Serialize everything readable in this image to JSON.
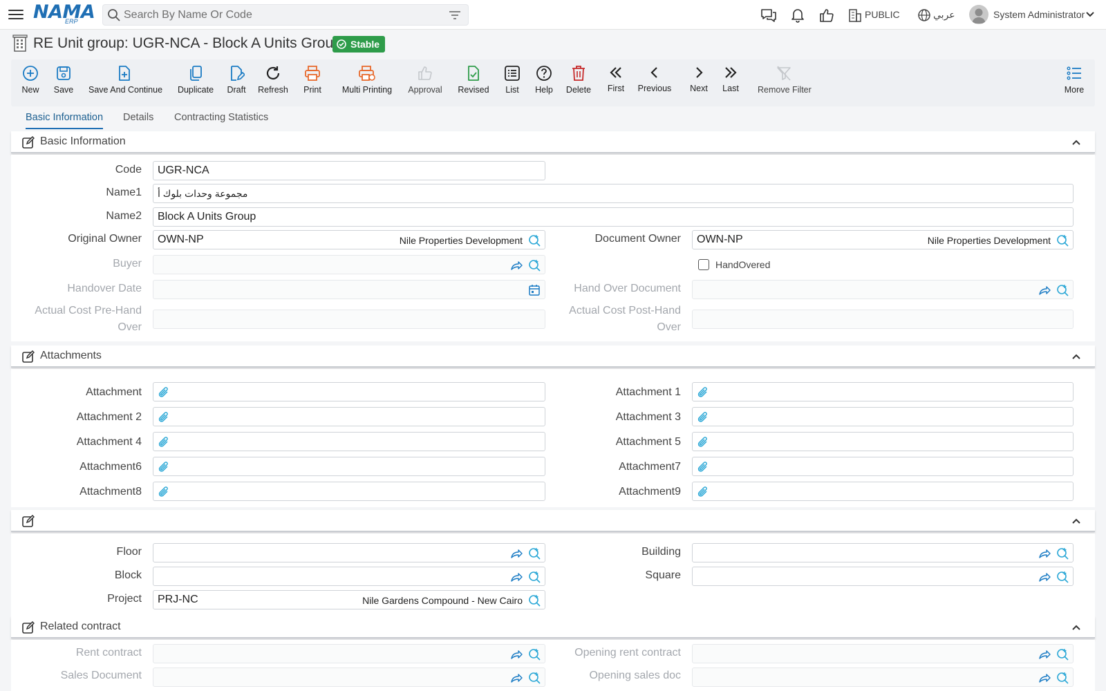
{
  "header": {
    "logo_text": "NAMA",
    "logo_sub": "ERP",
    "search_placeholder": "Search By Name Or Code",
    "company": "PUBLIC",
    "language": "عربي",
    "user": "System Administrator"
  },
  "title": {
    "text": "RE Unit group: UGR-NCA - Block A Units Group",
    "status": "Stable"
  },
  "toolbar": {
    "new": "New",
    "save": "Save",
    "save_continue": "Save And Continue",
    "duplicate": "Duplicate",
    "draft": "Draft",
    "refresh": "Refresh",
    "print": "Print",
    "multi_printing": "Multi Printing",
    "approval": "Approval",
    "revised": "Revised",
    "list": "List",
    "help": "Help",
    "delete": "Delete",
    "first": "First",
    "previous": "Previous",
    "next": "Next",
    "last": "Last",
    "remove_filter": "Remove Filter",
    "more": "More"
  },
  "tabs": [
    "Basic Information",
    "Details",
    "Contracting Statistics"
  ],
  "basic": {
    "title": "Basic Information",
    "code_label": "Code",
    "code": "UGR-NCA",
    "name1_label": "Name1",
    "name1": "مجموعة وحدات بلوك أ",
    "name2_label": "Name2",
    "name2": "Block A Units Group",
    "original_owner_label": "Original Owner",
    "original_owner_code": "OWN-NP",
    "original_owner_name": "Nile Properties Development",
    "document_owner_label": "Document Owner",
    "document_owner_code": "OWN-NP",
    "document_owner_name": "Nile Properties Development",
    "buyer_label": "Buyer",
    "handovered_label": "HandOvered",
    "handover_date_label": "Handover Date",
    "handover_document_label": "Hand Over Document",
    "actual_pre_label_1": "Actual Cost Pre-Hand",
    "actual_pre_label_2": "Over",
    "actual_post_label_1": "Actual Cost Post-Hand",
    "actual_post_label_2": "Over"
  },
  "attachments": {
    "title": "Attachments",
    "labels": [
      "Attachment",
      "Attachment 1",
      "Attachment 2",
      "Attachment 3",
      "Attachment 4",
      "Attachment 5",
      "Attachment6",
      "Attachment7",
      "Attachment8",
      "Attachment9"
    ]
  },
  "location": {
    "title": "",
    "floor_label": "Floor",
    "building_label": "Building",
    "block_label": "Block",
    "square_label": "Square",
    "project_label": "Project",
    "project_code": "PRJ-NC",
    "project_name": "Nile Gardens Compound - New Cairo"
  },
  "related": {
    "title": "Related contract",
    "rent_contract_label": "Rent contract",
    "opening_rent_label": "Opening rent contract",
    "sales_document_label": "Sales Document",
    "opening_sales_label": "Opening sales doc"
  }
}
